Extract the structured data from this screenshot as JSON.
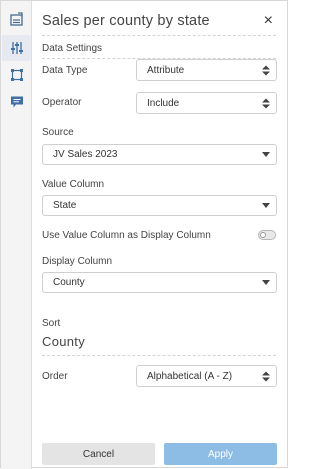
{
  "rail": {
    "icons": [
      "chart-settings-icon",
      "sliders-icon",
      "frame-icon",
      "comment-icon"
    ],
    "active": "sliders-icon"
  },
  "panel": {
    "title": "Sales per county by state",
    "close_glyph": "×",
    "section_title": "Data Settings"
  },
  "fields": {
    "data_type": {
      "label": "Data Type",
      "value": "Attribute"
    },
    "operator": {
      "label": "Operator",
      "value": "Include"
    },
    "source": {
      "label": "Source",
      "value": "JV Sales 2023"
    },
    "value_column": {
      "label": "Value Column",
      "value": "State"
    },
    "use_value_as_display": {
      "label": "Use Value Column as Display Column",
      "enabled": false
    },
    "display_column": {
      "label": "Display Column",
      "value": "County"
    },
    "sort": {
      "label": "Sort",
      "value": "County"
    },
    "order": {
      "label": "Order",
      "value": "Alphabetical (A - Z)"
    }
  },
  "buttons": {
    "cancel": "Cancel",
    "apply": "Apply"
  },
  "colors": {
    "apply_bg": "#8dbde5",
    "cancel_bg": "#e4e4e4",
    "rail_bg": "#f4f4f4"
  }
}
